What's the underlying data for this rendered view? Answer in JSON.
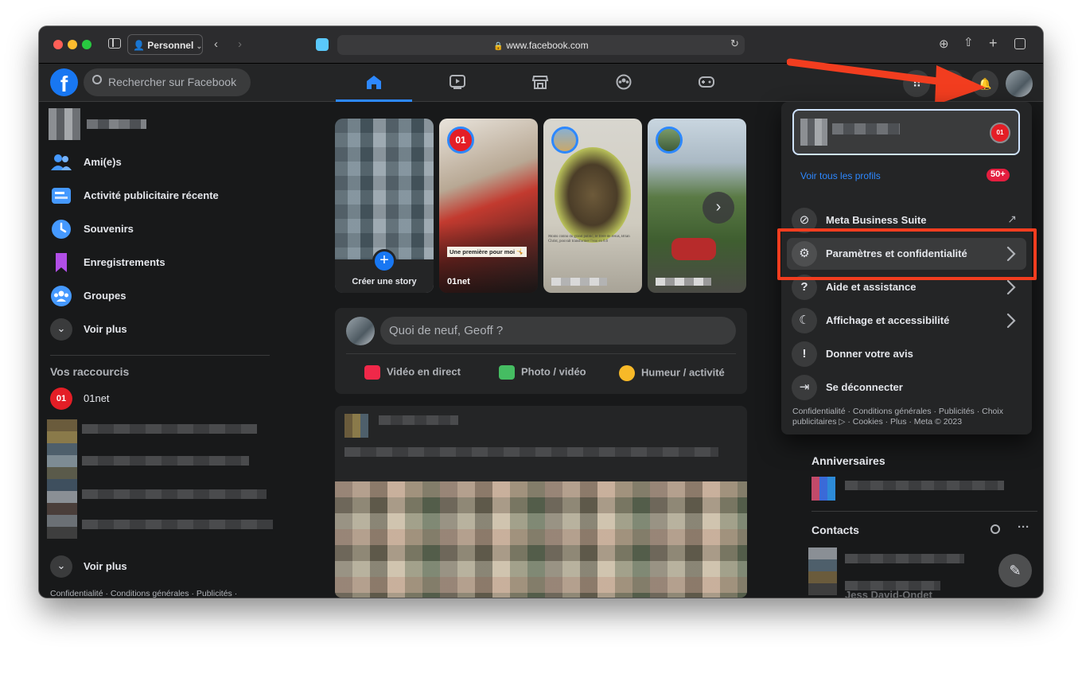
{
  "browser": {
    "profile_label": "Personnel",
    "url": "www.facebook.com"
  },
  "fb": {
    "search_placeholder": "Rechercher sur Facebook",
    "nav_tabs": [
      "home",
      "watch",
      "marketplace",
      "groups",
      "gaming"
    ]
  },
  "sidebar": {
    "items": [
      {
        "label": "Ami(e)s",
        "icon": "friends-icon"
      },
      {
        "label": "Activité publicitaire récente",
        "icon": "ad-activity-icon"
      },
      {
        "label": "Souvenirs",
        "icon": "memories-icon"
      },
      {
        "label": "Enregistrements",
        "icon": "saved-icon"
      },
      {
        "label": "Groupes",
        "icon": "groups-icon"
      }
    ],
    "see_more": "Voir plus",
    "shortcuts_title": "Vos raccourcis",
    "shortcut_01net": "01net",
    "see_more_2": "Voir plus",
    "footer": "Confidentialité · Conditions générales · Publicités ·"
  },
  "stories": {
    "create_label": "Créer une story",
    "story2_name": "01net",
    "story2_caption": "Une première pour moi 🤸",
    "story3_caption": "Moins connu du grand public, le frère de Jésus, Brian Christ, pouvait transformer l'eau en 8.6"
  },
  "composer": {
    "placeholder": "Quoi de neuf, Geoff ?",
    "live_label": "Vidéo en direct",
    "photo_label": "Photo / vidéo",
    "feeling_label": "Humeur / activité"
  },
  "account_menu": {
    "see_all_profiles": "Voir tous les profils",
    "profiles_badge": "50+",
    "items": [
      {
        "label": "Meta Business Suite",
        "icon": "meta-business-icon"
      },
      {
        "label": "Paramètres et confidentialité",
        "icon": "gear-icon"
      },
      {
        "label": "Aide et assistance",
        "icon": "help-icon"
      },
      {
        "label": "Affichage et accessibilité",
        "icon": "moon-icon"
      },
      {
        "label": "Donner votre avis",
        "icon": "feedback-icon"
      },
      {
        "label": "Se déconnecter",
        "icon": "logout-icon"
      }
    ],
    "footer_line1": "Confidentialité · Conditions générales · Publicités · Choix",
    "footer_line2": "publicitaires ▷ · Cookies · Plus · Meta © 2023"
  },
  "right_column": {
    "birthdays_title": "Anniversaires",
    "contacts_title": "Contacts",
    "partial_contact": "Jess David-Ondet"
  },
  "colors": {
    "accent": "#2d88ff",
    "annotation_red": "#f23d1f",
    "bg": "#18191a",
    "surface": "#242526"
  }
}
